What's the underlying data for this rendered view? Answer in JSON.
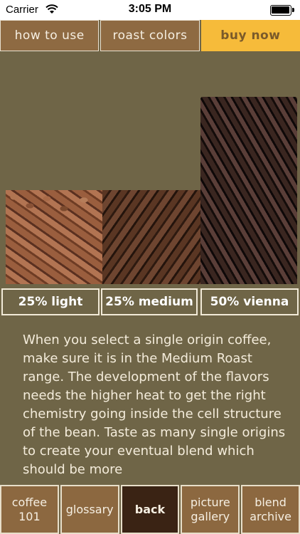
{
  "status_bar": {
    "carrier": "Carrier",
    "time": "3:05 PM"
  },
  "top_tabs": [
    {
      "label": "how to use",
      "active": false
    },
    {
      "label": "roast colors",
      "active": false
    },
    {
      "label": "buy now",
      "active": true
    }
  ],
  "blend": {
    "light": "25% light",
    "medium": "25% medium",
    "vienna": "50% vienna"
  },
  "body_text": "When you select a single origin coffee, make sure it is in the Medium Roast range. The development of the flavors needs the higher heat to get the right chemistry going inside the cell structure of the bean. Taste as many single origins to create your eventual blend which should be more",
  "bottom_tabs": [
    {
      "label": "coffee 101",
      "active": false
    },
    {
      "label": "glossary",
      "active": false
    },
    {
      "label": "back",
      "active": true
    },
    {
      "label": "picture gallery",
      "active": false
    },
    {
      "label": "blend archive",
      "active": false
    }
  ],
  "colors": {
    "background": "#6f6547",
    "tab_brown": "#8e6a42",
    "tab_active_yellow": "#f6bb3a",
    "back_dark": "#3a2314"
  }
}
